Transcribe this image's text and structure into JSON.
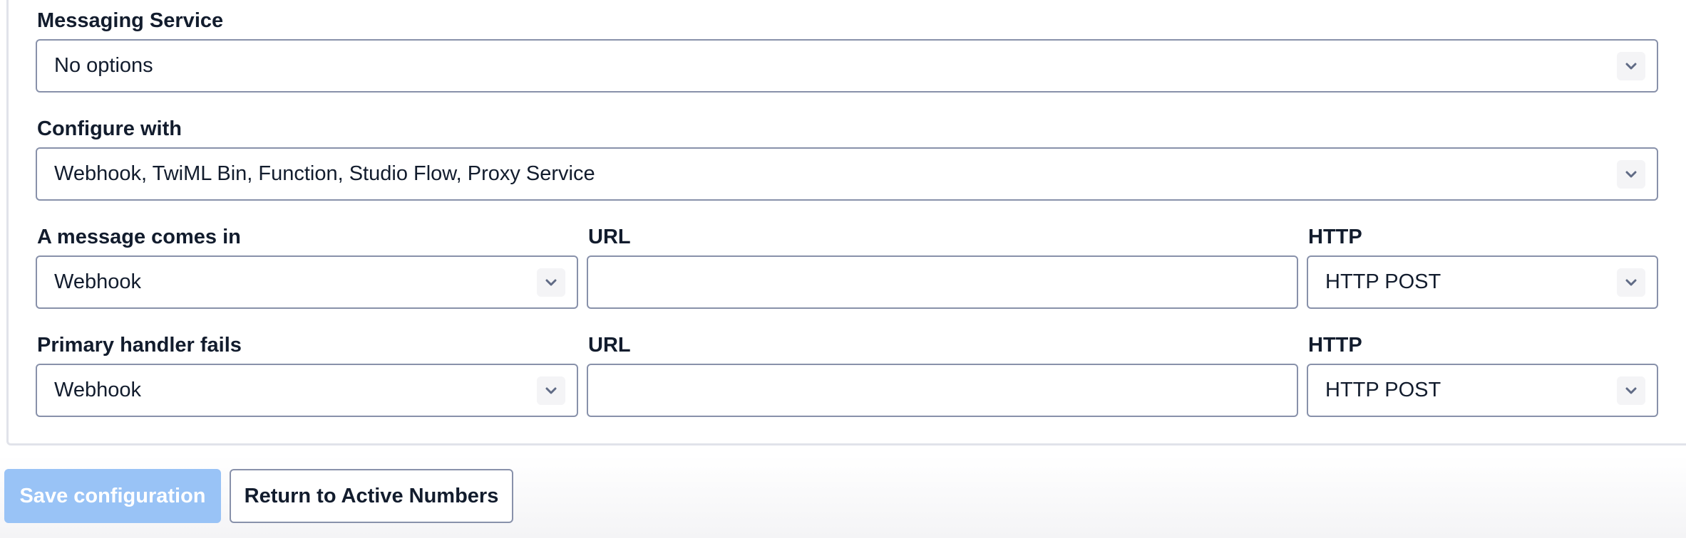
{
  "messaging_service": {
    "label": "Messaging Service",
    "value": "No options"
  },
  "configure_with": {
    "label": "Configure with",
    "value": "Webhook, TwiML Bin, Function, Studio Flow, Proxy Service"
  },
  "message_comes_in": {
    "label": "A message comes in",
    "value": "Webhook",
    "url_label": "URL",
    "url_value": "",
    "http_label": "HTTP",
    "http_value": "HTTP POST"
  },
  "primary_handler_fails": {
    "label": "Primary handler fails",
    "value": "Webhook",
    "url_label": "URL",
    "url_value": "",
    "http_label": "HTTP",
    "http_value": "HTTP POST"
  },
  "actions": {
    "save_label": "Save configuration",
    "return_label": "Return to Active Numbers"
  },
  "colors": {
    "primary_disabled": "#99c3f6",
    "border": "#8891aa",
    "text": "#121c2d"
  },
  "icons": {
    "select_chevron": "chevron-down-icon"
  }
}
